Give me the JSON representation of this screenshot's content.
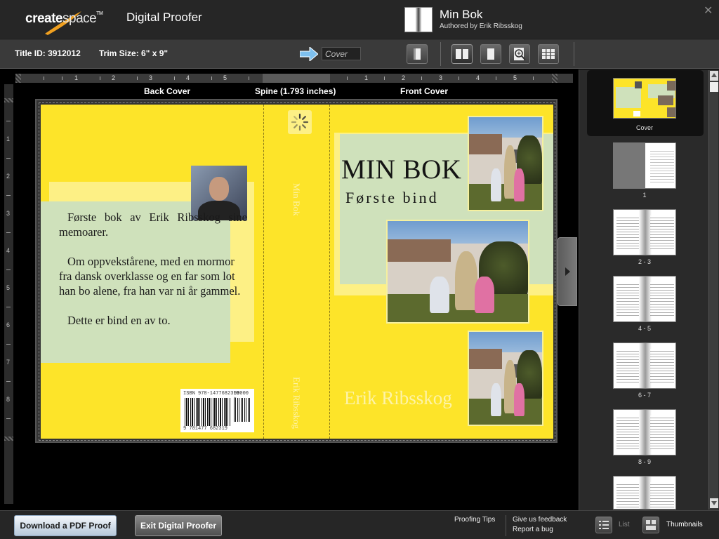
{
  "header": {
    "logo_bold": "create",
    "logo_light": "space",
    "logo_tm": "TM",
    "app_title": "Digital Proofer",
    "book_title": "Min Bok",
    "book_author": "Authored by Erik Ribsskog",
    "close_glyph": "✕"
  },
  "toolbar": {
    "title_id": "Title ID: 3912012",
    "trim_size": "Trim Size: 6\" x 9\"",
    "nav_value": "Cover",
    "buttons": [
      "single-page-icon",
      "two-page-spread-icon",
      "page-icon",
      "zoom-icon",
      "grid-icon"
    ]
  },
  "rulers": {
    "horizontal_left": [
      "1",
      "2",
      "3",
      "4",
      "5"
    ],
    "horizontal_right": [
      "1",
      "2",
      "3",
      "4",
      "5"
    ],
    "vertical": [
      "1",
      "2",
      "3",
      "4",
      "5",
      "6",
      "7",
      "8"
    ]
  },
  "sections": {
    "back": "Back Cover",
    "spine": "Spine (1.793 inches)",
    "front": "Front Cover"
  },
  "cover": {
    "back_paragraphs": [
      "Første bok av Erik Ribsskog sine memoarer.",
      "Om oppvekstårene, med en mormor fra dansk overklasse og en far som lot han bo alene, fra han var ni år gammel.",
      "Dette er bind en av to."
    ],
    "isbn_label": "ISBN 978-1477682319",
    "price_code": "90000 >",
    "barcode_number": "9 781477 682319",
    "spine_title": "Min Bok",
    "spine_author": "Erik Ribsskog",
    "front_title": "MIN BOK",
    "front_subtitle": "Første bind",
    "front_author": "Erik Ribsskog"
  },
  "thumbnails": [
    {
      "label": "Cover",
      "selected": true
    },
    {
      "label": "1"
    },
    {
      "label": "2 - 3"
    },
    {
      "label": "4 - 5"
    },
    {
      "label": "6 - 7"
    },
    {
      "label": "8 - 9"
    }
  ],
  "footer": {
    "download_pdf": "Download a PDF Proof",
    "exit": "Exit Digital Proofer",
    "proofing_tips": "Proofing Tips",
    "feedback": "Give us feedback",
    "report_bug": "Report a bug",
    "view_list": "List",
    "view_thumbnails": "Thumbnails"
  },
  "colors": {
    "cover_yellow": "#fde429",
    "cover_green": "#cfe1bb",
    "accent_blue": "#6fb1e6"
  }
}
